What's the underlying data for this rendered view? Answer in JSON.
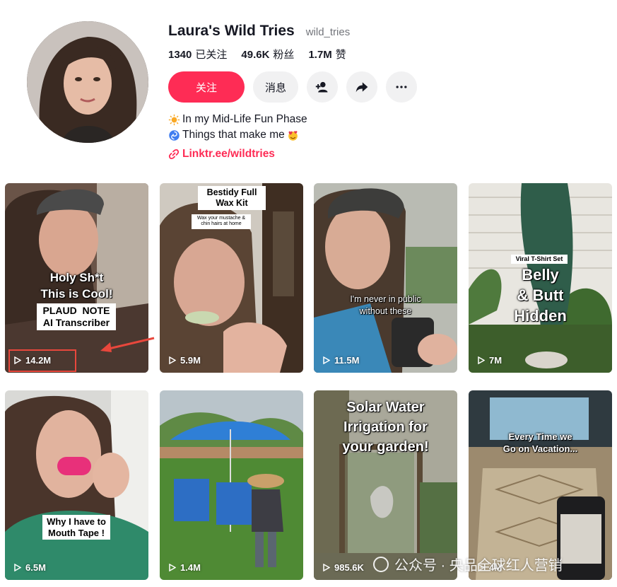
{
  "profile": {
    "name": "Laura's Wild Tries",
    "handle": "wild_tries",
    "following_count": "1340",
    "following_label": "已关注",
    "followers_count": "49.6K",
    "followers_label": "粉丝",
    "likes_count": "1.7M",
    "likes_label": "赞",
    "follow_button": "关注",
    "message_button": "消息",
    "bio_line1": "In my Mid-Life Fun Phase",
    "bio_line2": "Things that make me",
    "link": "Linktr.ee/wildtries"
  },
  "videos": [
    {
      "views": "14.2M",
      "caption1": "Holy Sh*t",
      "caption2": "This is Cool!",
      "box1": "PLAUD  NOTE",
      "box2": "AI Transcriber"
    },
    {
      "views": "5.9M",
      "box1": "Bestidy Full",
      "box2": "Wax Kit",
      "note1": "Wax your mustache &",
      "note2": "chin hairs at home"
    },
    {
      "views": "11.5M",
      "caption1": "I'm never in public",
      "caption2": "without these"
    },
    {
      "views": "7M",
      "tag": "Viral T-Shirt Set",
      "caption1": "Belly",
      "caption2": "& Butt",
      "caption3": "Hidden"
    },
    {
      "views": "6.5M",
      "box1": "Why I have to",
      "box2": "Mouth Tape !"
    },
    {
      "views": "1.4M"
    },
    {
      "views": "985.6K",
      "caption1": "Solar Water",
      "caption2": "Irrigation for",
      "caption3": "your garden!"
    },
    {
      "views": "4M",
      "caption1": "Every Time we",
      "caption2": "Go on Vacation..."
    }
  ],
  "watermark": "公众号 · 央品全球红人营销",
  "colors": {
    "accent": "#fe2c55",
    "highlight": "#e8473c"
  }
}
